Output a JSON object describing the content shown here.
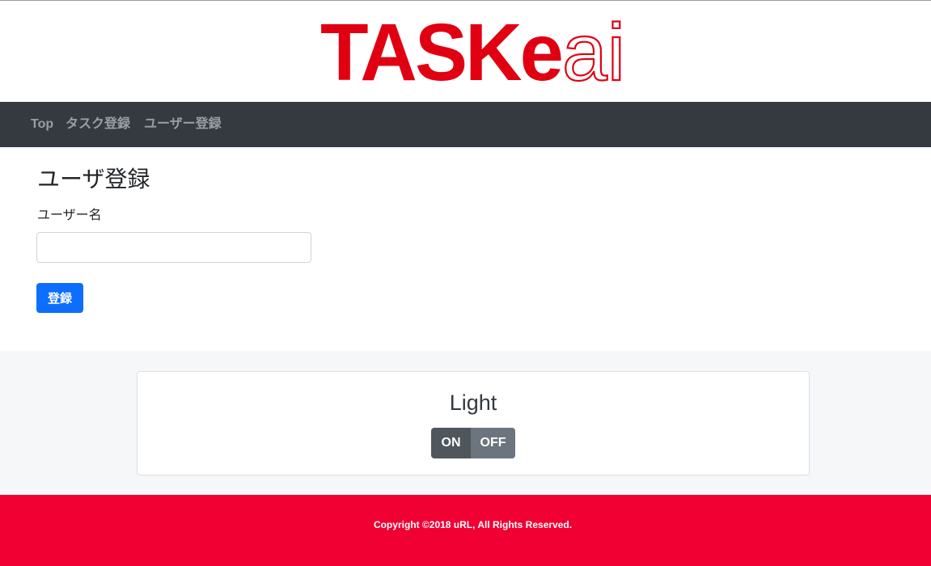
{
  "brand": {
    "logo_text_main": "TASKe",
    "logo_text_suffix": "ai",
    "logo_color": "#e00012"
  },
  "nav": {
    "items": [
      {
        "label": "Top"
      },
      {
        "label": "タスク登録"
      },
      {
        "label": "ユーザー登録"
      }
    ]
  },
  "form": {
    "title": "ユーザ登録",
    "username_label": "ユーザー名",
    "username_value": "",
    "submit_label": "登録"
  },
  "light": {
    "title": "Light",
    "on_label": "ON",
    "off_label": "OFF"
  },
  "footer": {
    "copyright": "Copyright ©2018 uRL, All Rights Reserved.",
    "color": "#f00033"
  },
  "colors": {
    "navbar": "#343a40",
    "primary": "#0d6efd",
    "toggle_on": "#4f565c",
    "toggle_off": "#6c757d"
  }
}
